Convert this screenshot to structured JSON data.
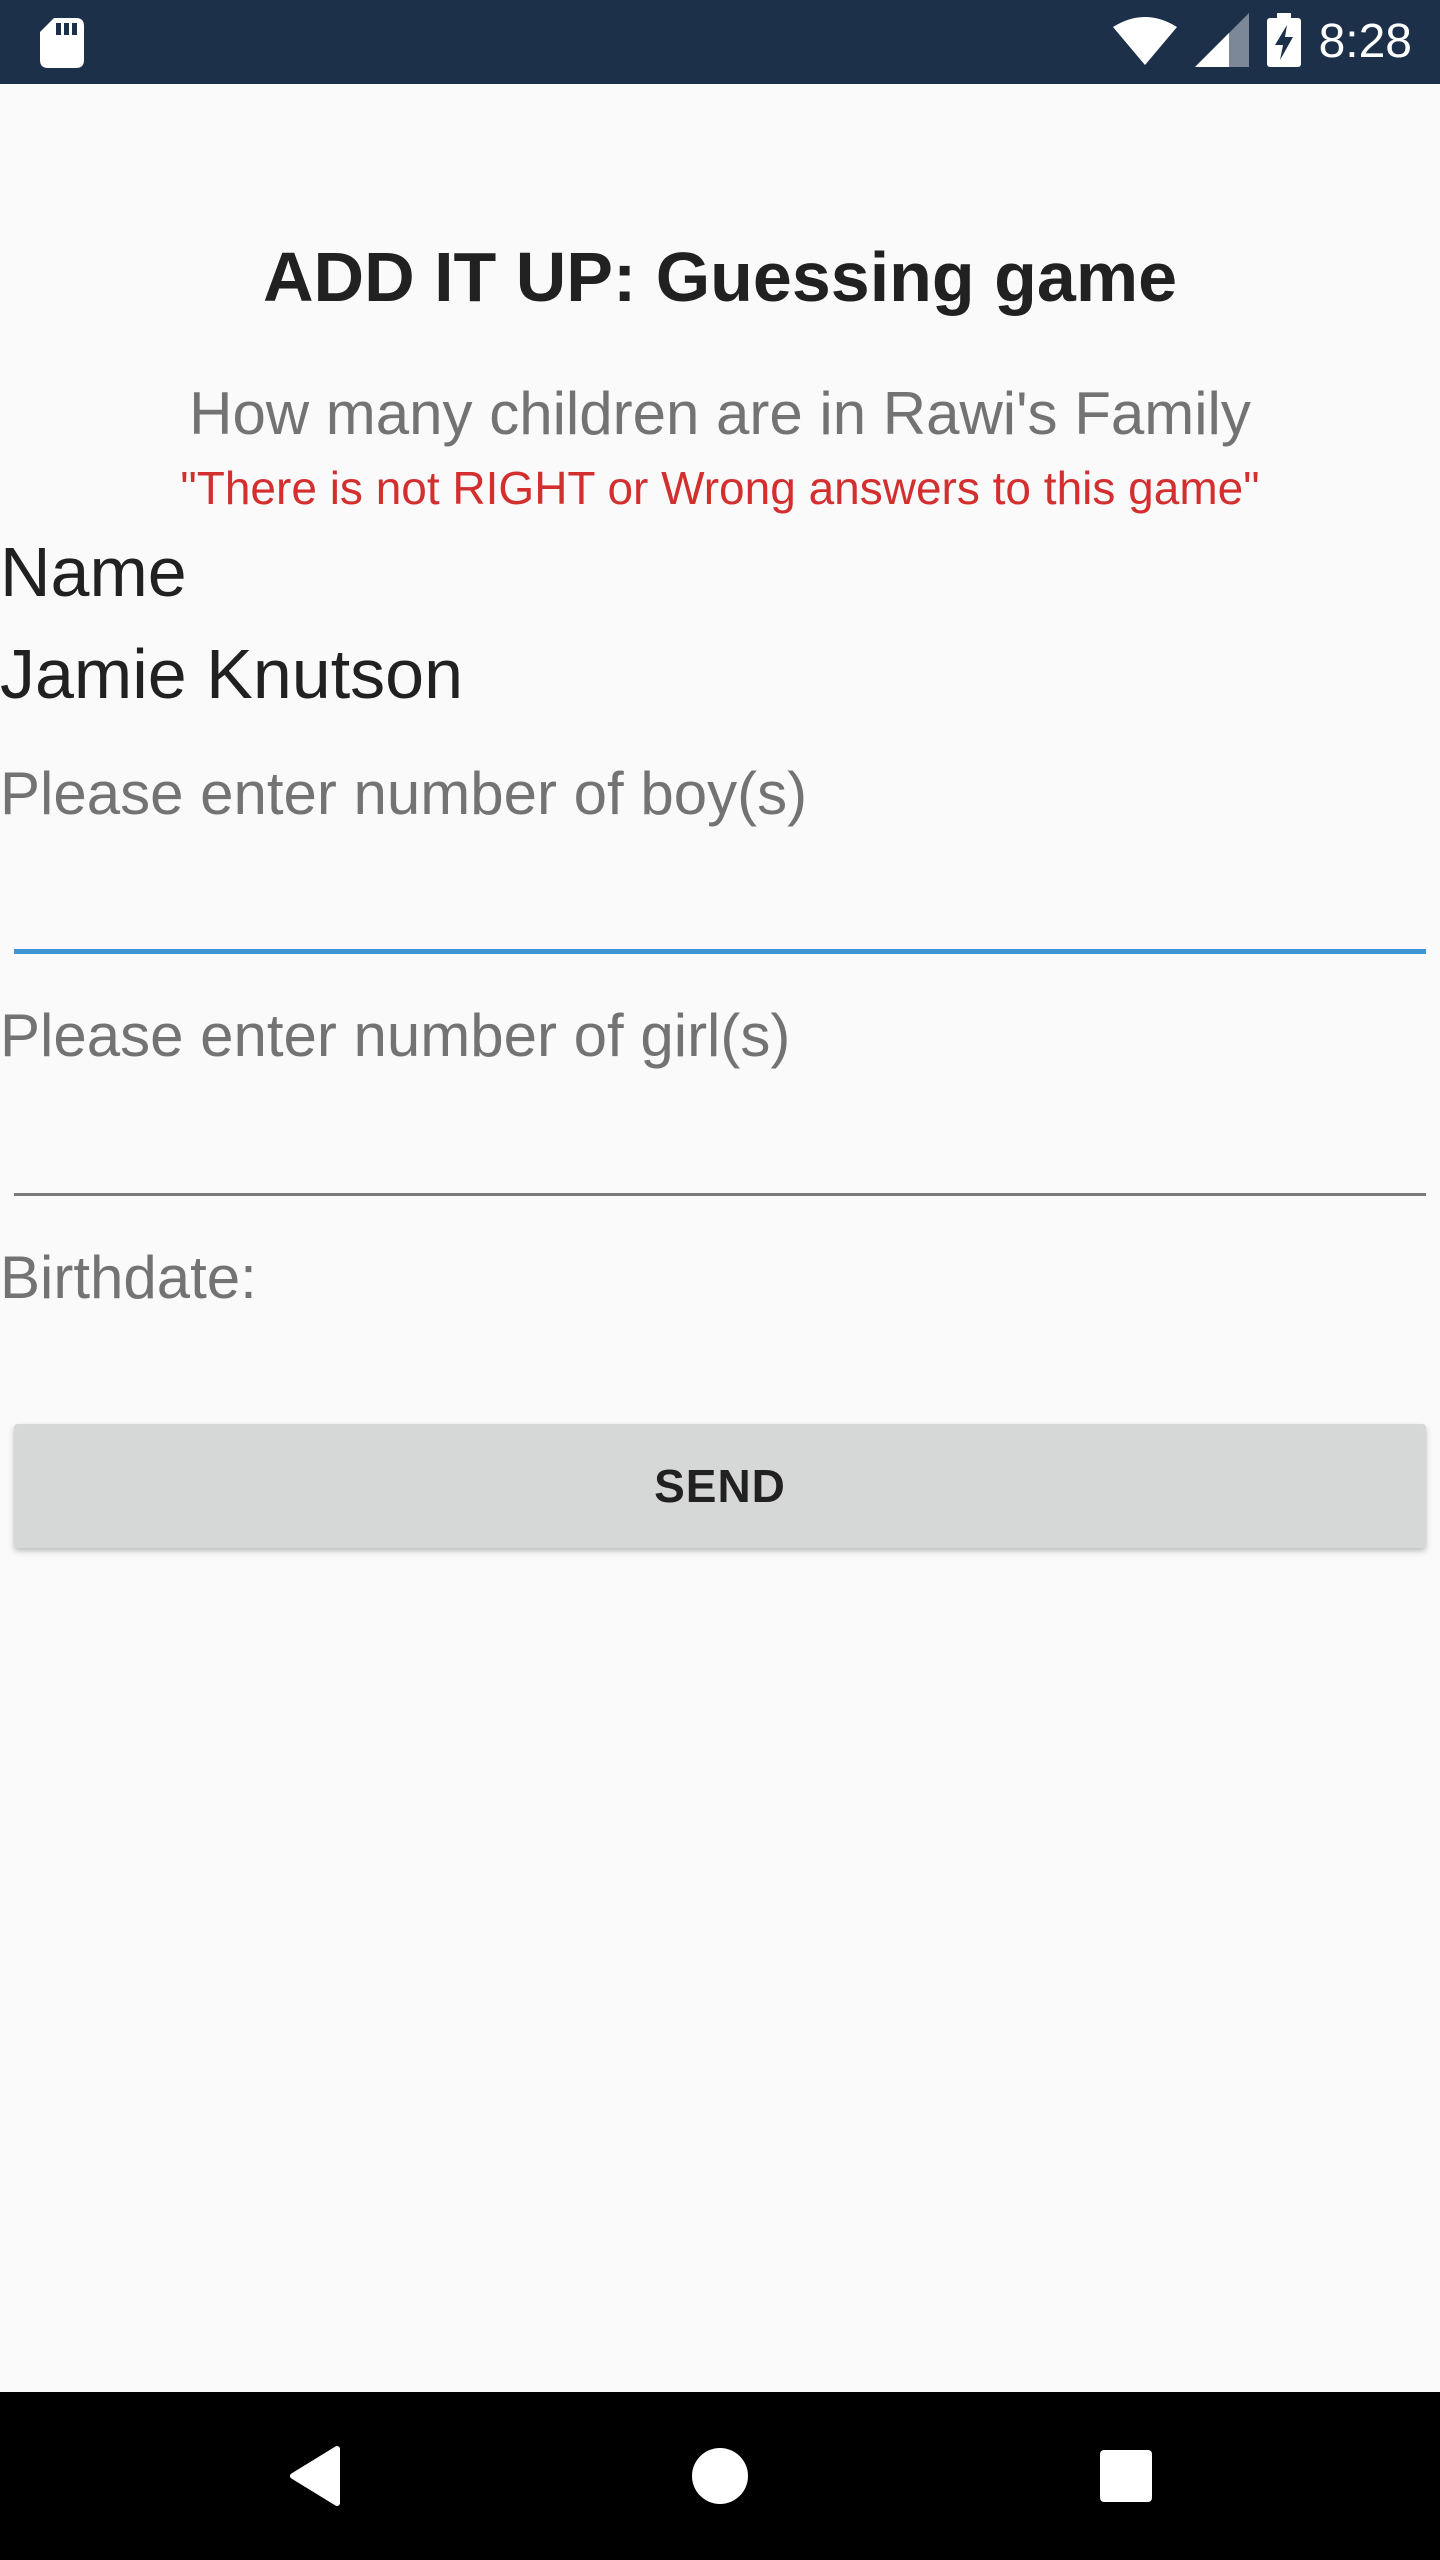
{
  "status_bar": {
    "time": "8:28",
    "icons": [
      "sd-card-icon",
      "wifi-icon",
      "signal-icon",
      "battery-charging-icon"
    ]
  },
  "header": {
    "title": "ADD IT UP: Guessing game",
    "subtitle": "How many children are in Rawi's Family",
    "note": "\"There is not RIGHT or Wrong answers to this game\""
  },
  "form": {
    "name_label": "Name",
    "name_value": "Jamie Knutson",
    "boys_label": "Please enter number of boy(s)",
    "boys_value": "",
    "girls_label": "Please enter number of girl(s)",
    "girls_value": "",
    "birthdate_label": "Birthdate:",
    "send_label": "SEND"
  },
  "nav_bar": {
    "buttons": [
      "back-icon",
      "home-icon",
      "recents-icon"
    ]
  },
  "colors": {
    "status_bar": "#1c3049",
    "background": "#fafafa",
    "accent": "#3d97d4",
    "note_red": "#d32f2f",
    "button_bg": "#d6d7d7"
  }
}
